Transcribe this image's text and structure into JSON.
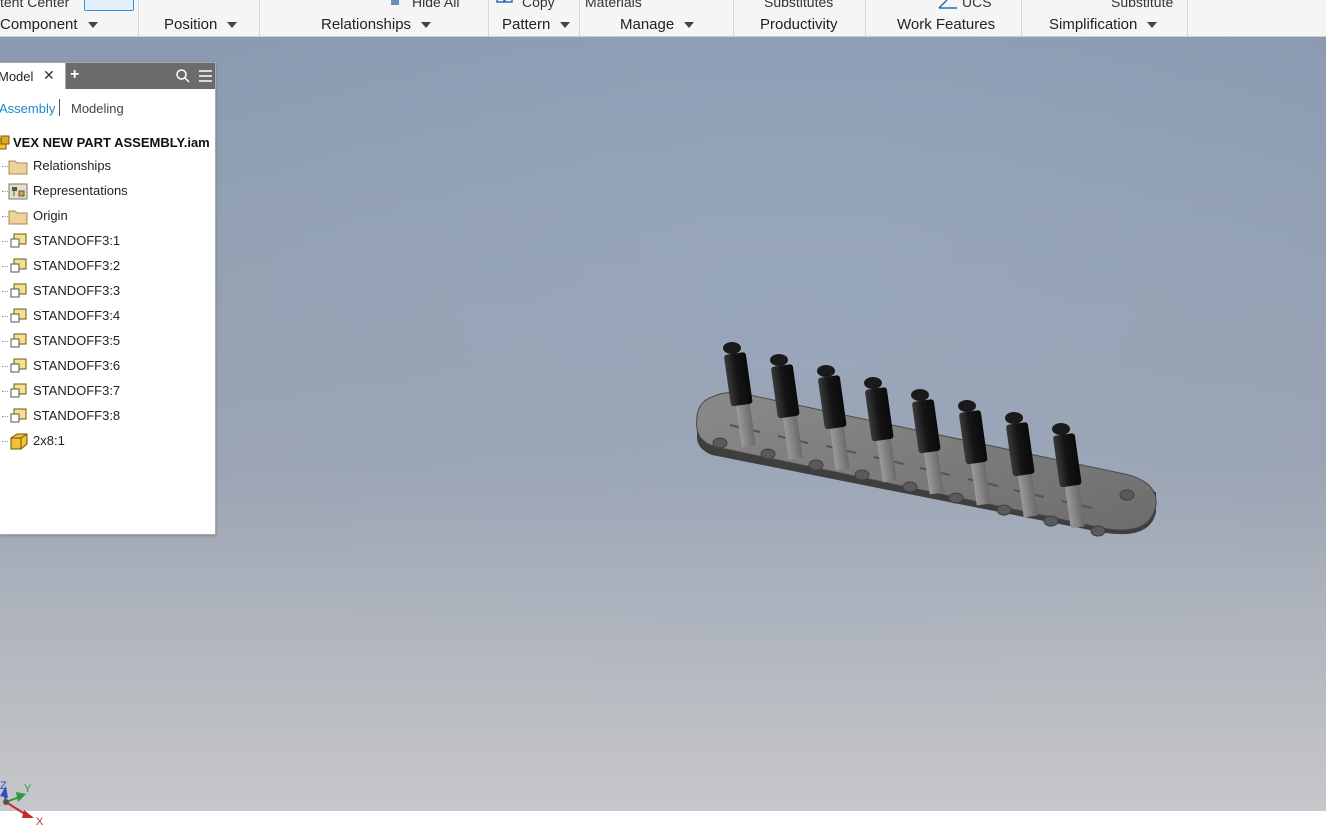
{
  "ribbon": {
    "top_fragments": [
      "tent Center",
      "Hide All",
      "Copy",
      "Materials",
      "Substitutes",
      "UCS",
      "Substitute"
    ],
    "panels": [
      {
        "label": "Component",
        "dropdown": true
      },
      {
        "label": "Position",
        "dropdown": true
      },
      {
        "label": "Relationships",
        "dropdown": true
      },
      {
        "label": "Pattern",
        "dropdown": true
      },
      {
        "label": "Manage",
        "dropdown": true
      },
      {
        "label": "Productivity",
        "dropdown": false
      },
      {
        "label": "Work Features",
        "dropdown": false
      },
      {
        "label": "Simplification",
        "dropdown": true
      }
    ]
  },
  "browser": {
    "tab_label": "Model",
    "close_icon": "close-icon",
    "add_icon": "plus-icon",
    "search_icon": "search-icon",
    "menu_icon": "hamburger-menu-icon",
    "mode_active": "Assembly",
    "mode_inactive": "Modeling",
    "root": "VEX NEW PART ASSEMBLY.iam",
    "items": [
      {
        "label": "Relationships",
        "icon": "folder-icon"
      },
      {
        "label": "Representations",
        "icon": "representations-icon"
      },
      {
        "label": "Origin",
        "icon": "folder-icon"
      },
      {
        "label": "STANDOFF3:1",
        "icon": "part-link-icon"
      },
      {
        "label": "STANDOFF3:2",
        "icon": "part-link-icon"
      },
      {
        "label": "STANDOFF3:3",
        "icon": "part-link-icon"
      },
      {
        "label": "STANDOFF3:4",
        "icon": "part-link-icon"
      },
      {
        "label": "STANDOFF3:5",
        "icon": "part-link-icon"
      },
      {
        "label": "STANDOFF3:6",
        "icon": "part-link-icon"
      },
      {
        "label": "STANDOFF3:7",
        "icon": "part-link-icon"
      },
      {
        "label": "STANDOFF3:8",
        "icon": "part-link-icon"
      },
      {
        "label": "2x8:1",
        "icon": "part-icon"
      }
    ]
  },
  "triad": {
    "x": "X",
    "y": "Y",
    "z": "Z"
  },
  "colors": {
    "accent": "#1b8ac9",
    "part_yellow": "#f2c230",
    "folder_tan": "#e9c98a",
    "tab_bar": "#6b6b6b",
    "axis_x": "#c8282a",
    "axis_y": "#2f9a3c",
    "axis_z": "#2c4fc8"
  }
}
